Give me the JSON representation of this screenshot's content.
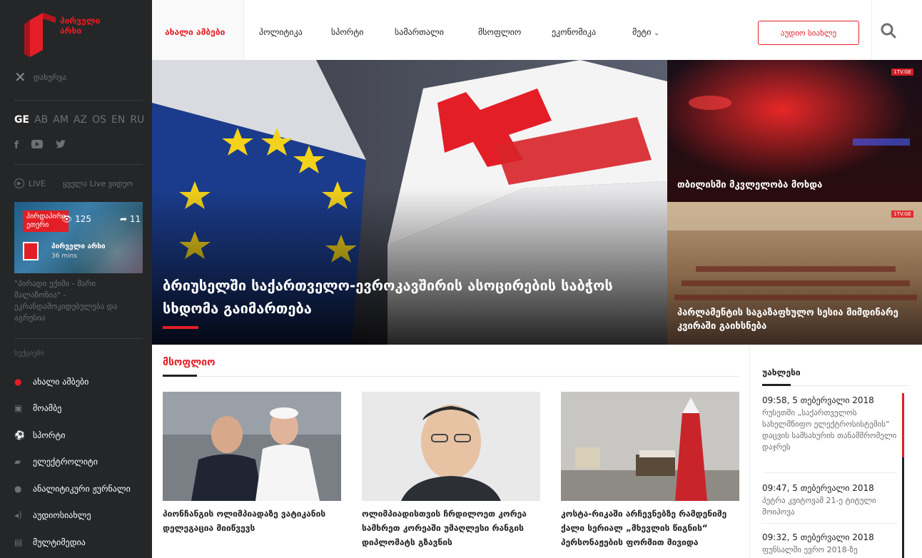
{
  "brand": {
    "logo_text": "პირველი\nარხი"
  },
  "sidebar": {
    "close_label": "დახურვა",
    "languages": [
      "GE",
      "AB",
      "AM",
      "AZ",
      "OS",
      "EN",
      "RU"
    ],
    "social_icons": [
      "facebook-icon",
      "youtube-icon",
      "twitter-icon"
    ],
    "live_label": "LIVE",
    "all_live_label": "ყველა Live ვიდეო",
    "live_card": {
      "badge": "პირდაპირი ეთერი",
      "views": "125",
      "shares": "11",
      "channel": "პირველი არხი",
      "time": "36 mins"
    },
    "live_description": "\"პირადი ექიმი - მარი მალაზონია\" - ეკრანდამოკიდებულება და აგრესია",
    "sections_title": "სექციები",
    "menu": [
      {
        "label": "ახალი ამბები",
        "icon": "globe-icon"
      },
      {
        "label": "მოამბე",
        "icon": "play-icon"
      },
      {
        "label": "სპორტი",
        "icon": "ball-icon"
      },
      {
        "label": "ელექტროლიტი",
        "icon": "note-icon"
      },
      {
        "label": "ანალიტიკური ჟურნალი",
        "icon": "chat-icon"
      },
      {
        "label": "აუდიოსიახლე",
        "icon": "audio-icon"
      },
      {
        "label": "მულტიმედია",
        "icon": "film-icon"
      }
    ]
  },
  "nav": {
    "items": [
      "ახალი ამბები",
      "პოლიტიკა",
      "სპორტი",
      "სამართალი",
      "მსოფლიო",
      "ეკონომიკა",
      "მეტი"
    ],
    "radio_label": "აუდიო სიახლე"
  },
  "hero": {
    "main_title": "ბრიუსელში საქართველო-ევროკავშირის ასოცირების საბჭოს სხდომა გაიმართება",
    "side": [
      {
        "title": "თბილისში მკვლელობა მოხდა",
        "badge": "1TV.GE"
      },
      {
        "title": "პარლამენტის საგაზაფხულო სესია მიმდინარე კვირაში გაიხსნება",
        "badge": "1TV.GE"
      }
    ]
  },
  "section": {
    "label": "მსოფლიო",
    "cards": [
      {
        "title": "პიონჩანგის ოლიმპიადაზე ვატიკანის დელეგაცია მიიწვევს"
      },
      {
        "title": "ოლიმპიადისთვის ჩრდილოეთ კორეა სამხრეთ კორეაში უმაღლესი რანგის დიპლომატს გზავნის"
      },
      {
        "title": "კოსტა-რიკაში არჩევნებზე რამდენიმე ქალი სერიალ „მხევლის წიგნის“ პერსონაჟების ფორმით მივიდა"
      }
    ]
  },
  "latest": {
    "title": "უახლესი",
    "items": [
      {
        "time": "09:58, 5 თებერვალი 2018",
        "text": "რუსეთში „საქართველოს სახელმწიფო ელექტროსისტემის“ დაცვის სამსახურის თანამშრომელი დაჯრეს"
      },
      {
        "time": "09:47, 5 თებერვალი 2018",
        "text": "პეტრა კვიტოვამ 21-ე ტიტული მოიპოვა"
      },
      {
        "time": "09:32, 5 თებერვალი 2018",
        "text": "ფუნსალში ევრო 2018-ზე"
      }
    ]
  },
  "colors": {
    "accent": "#e41e26",
    "sidebar_bg": "#252628"
  }
}
